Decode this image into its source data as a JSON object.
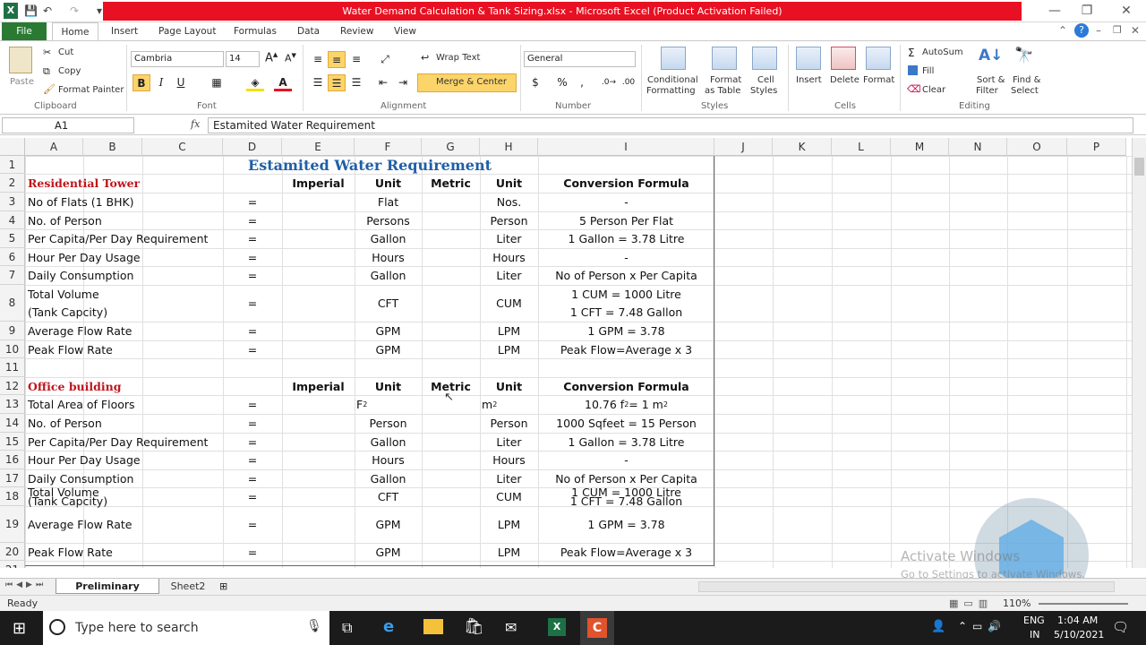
{
  "window": {
    "title": "Water Demand Calculation & Tank Sizing.xlsx  -  Microsoft Excel (Product Activation Failed)",
    "controls": [
      "—",
      "❐",
      "✕"
    ]
  },
  "tabs": [
    "File",
    "Home",
    "Insert",
    "Page Layout",
    "Formulas",
    "Data",
    "Review",
    "View"
  ],
  "ribbon": {
    "clipboard": {
      "paste": "Paste",
      "cut": "Cut",
      "copy": "Copy",
      "format_painter": "Format Painter",
      "label": "Clipboard"
    },
    "font": {
      "name": "Cambria",
      "size": "14",
      "label": "Font",
      "bold": "B",
      "italic": "I",
      "underline": "U"
    },
    "alignment": {
      "wrap_text": "Wrap Text",
      "merge_center": "Merge & Center",
      "label": "Alignment"
    },
    "number": {
      "format": "General",
      "currency": "$",
      "percent": "%",
      "comma": ",",
      "label": "Number"
    },
    "styles": {
      "conditional": "Conditional",
      "conditional2": "Formatting",
      "format_table": "Format",
      "format_table2": "as Table",
      "cell_styles": "Cell",
      "cell_styles2": "Styles",
      "label": "Styles"
    },
    "cells": {
      "insert": "Insert",
      "delete": "Delete",
      "format": "Format",
      "label": "Cells"
    },
    "editing": {
      "autosum": "AutoSum",
      "fill": "Fill",
      "clear": "Clear",
      "sort": "Sort &",
      "sort2": "Filter",
      "find": "Find &",
      "find2": "Select",
      "label": "Editing"
    }
  },
  "formula_bar": {
    "name_box": "A1",
    "fx": "fx",
    "content": "Estamited Water Requirement"
  },
  "columns": [
    "A",
    "B",
    "C",
    "D",
    "E",
    "F",
    "G",
    "H",
    "I",
    "J",
    "K",
    "L",
    "M",
    "N",
    "O",
    "P"
  ],
  "rows": [
    "1",
    "2",
    "3",
    "4",
    "5",
    "6",
    "7",
    "8",
    "9",
    "10",
    "11",
    "12",
    "13",
    "14",
    "15",
    "16",
    "17",
    "18",
    "19",
    "20",
    "21"
  ],
  "sheet": {
    "title": "Estamited Water Requirement",
    "sections": [
      {
        "heading": "Residential Tower",
        "hdr_imperial": "Imperial",
        "hdr_unit": "Unit",
        "hdr_metric": "Metric",
        "hdr_unit2": "Unit",
        "hdr_formula": "Conversion Formula",
        "rows": [
          {
            "label": "No of Flats (1 BHK)",
            "eq": "=",
            "unit": "Flat",
            "unit2": "Nos.",
            "formula": "-"
          },
          {
            "label": "No. of Person",
            "eq": "=",
            "unit": "Persons",
            "unit2": "Person",
            "formula": "5 Person Per Flat"
          },
          {
            "label": "Per Capita/Per Day Requirement",
            "eq": "=",
            "unit": "Gallon",
            "unit2": "Liter",
            "formula": "1 Gallon = 3.78 Litre"
          },
          {
            "label": "Hour Per Day Usage",
            "eq": "=",
            "unit": "Hours",
            "unit2": "Hours",
            "formula": "-"
          },
          {
            "label": "Daily Consumption",
            "eq": "=",
            "unit": "Gallon",
            "unit2": "Liter",
            "formula": "No of Person x Per Capita"
          },
          {
            "label": "Total Volume",
            "label2": "(Tank Capcity)",
            "eq": "=",
            "unit": "CFT",
            "unit2": "CUM",
            "formula": "1 CUM = 1000 Litre",
            "formula2": "1 CFT = 7.48 Gallon"
          },
          {
            "label": "Average Flow Rate",
            "eq": "=",
            "unit": "GPM",
            "unit2": "LPM",
            "formula": "1 GPM = 3.78"
          },
          {
            "label": "Peak Flow Rate",
            "eq": "=",
            "unit": "GPM",
            "unit2": "LPM",
            "formula": "Peak Flow=Average x 3"
          }
        ]
      },
      {
        "heading": "Office building",
        "hdr_imperial": "Imperial",
        "hdr_unit": "Unit",
        "hdr_metric": "Metric",
        "hdr_unit2": "Unit",
        "hdr_formula": "Conversion Formula",
        "rows": [
          {
            "label": "Total Area of Floors",
            "eq": "=",
            "unit": "F",
            "unit_sup": "2",
            "unit2": "m",
            "unit2_sup": "2",
            "formula": "10.76 f",
            "formula_sup": "2",
            "formula_tail": " = 1 m",
            "formula_sup2": "2"
          },
          {
            "label": "No. of Person",
            "eq": "=",
            "unit": "Person",
            "unit2": "Person",
            "formula": "1000 Sqfeet = 15 Person"
          },
          {
            "label": "Per Capita/Per Day Requirement",
            "eq": "=",
            "unit": "Gallon",
            "unit2": "Liter",
            "formula": "1 Gallon = 3.78 Litre"
          },
          {
            "label": "Hour Per Day Usage",
            "eq": "=",
            "unit": "Hours",
            "unit2": "Hours",
            "formula": "-"
          },
          {
            "label": "Daily Consumption",
            "eq": "=",
            "unit": "Gallon",
            "unit2": "Liter",
            "formula": "No of Person x Per Capita"
          },
          {
            "label": "Total Volume",
            "label2": "(Tank Capcity)",
            "eq": "=",
            "unit": "CFT",
            "unit2": "CUM",
            "formula": "1 CUM = 1000 Litre",
            "formula2": "1 CFT = 7.48 Gallon"
          },
          {
            "label": "Average Flow Rate",
            "eq": "=",
            "unit": "GPM",
            "unit2": "LPM",
            "formula": "1 GPM = 3.78"
          },
          {
            "label": "Peak Flow Rate",
            "eq": "=",
            "unit": "GPM",
            "unit2": "LPM",
            "formula": "Peak Flow=Average x 3"
          }
        ]
      }
    ]
  },
  "sheet_tabs": [
    "Preliminary Design",
    "Sheet2"
  ],
  "status": {
    "ready": "Ready",
    "zoom": "110%"
  },
  "watermark": {
    "line1": "Activate Windows",
    "line2": "Go to Settings to activate Windows."
  },
  "taskbar": {
    "search_placeholder": "Type here to search",
    "lang": "ENG",
    "lang2": "IN",
    "time": "1:04 AM",
    "date": "5/10/2021"
  },
  "colors": {
    "file_tab": "#2a7a34",
    "title_bar": "#e81123",
    "heading_red": "#c0141b",
    "title_blue": "#1f5fa6"
  }
}
